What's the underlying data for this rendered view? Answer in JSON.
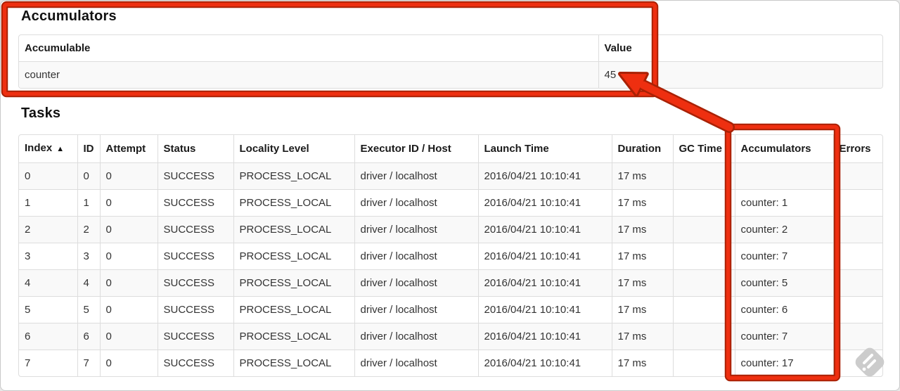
{
  "accumulators_section": {
    "title": "Accumulators",
    "table": {
      "headers": [
        "Accumulable",
        "Value"
      ],
      "rows": [
        [
          "counter",
          "45"
        ]
      ]
    }
  },
  "tasks_section": {
    "title": "Tasks",
    "table": {
      "headers": [
        "Index",
        "ID",
        "Attempt",
        "Status",
        "Locality Level",
        "Executor ID / Host",
        "Launch Time",
        "Duration",
        "GC Time",
        "Accumulators",
        "Errors"
      ],
      "sorted_column": "Index",
      "sort_icon": "▲",
      "rows": [
        [
          "0",
          "0",
          "0",
          "SUCCESS",
          "PROCESS_LOCAL",
          "driver / localhost",
          "2016/04/21 10:10:41",
          "17 ms",
          "",
          "",
          ""
        ],
        [
          "1",
          "1",
          "0",
          "SUCCESS",
          "PROCESS_LOCAL",
          "driver / localhost",
          "2016/04/21 10:10:41",
          "17 ms",
          "",
          "counter: 1",
          ""
        ],
        [
          "2",
          "2",
          "0",
          "SUCCESS",
          "PROCESS_LOCAL",
          "driver / localhost",
          "2016/04/21 10:10:41",
          "17 ms",
          "",
          "counter: 2",
          ""
        ],
        [
          "3",
          "3",
          "0",
          "SUCCESS",
          "PROCESS_LOCAL",
          "driver / localhost",
          "2016/04/21 10:10:41",
          "17 ms",
          "",
          "counter: 7",
          ""
        ],
        [
          "4",
          "4",
          "0",
          "SUCCESS",
          "PROCESS_LOCAL",
          "driver / localhost",
          "2016/04/21 10:10:41",
          "17 ms",
          "",
          "counter: 5",
          ""
        ],
        [
          "5",
          "5",
          "0",
          "SUCCESS",
          "PROCESS_LOCAL",
          "driver / localhost",
          "2016/04/21 10:10:41",
          "17 ms",
          "",
          "counter: 6",
          ""
        ],
        [
          "6",
          "6",
          "0",
          "SUCCESS",
          "PROCESS_LOCAL",
          "driver / localhost",
          "2016/04/21 10:10:41",
          "17 ms",
          "",
          "counter: 7",
          ""
        ],
        [
          "7",
          "7",
          "0",
          "SUCCESS",
          "PROCESS_LOCAL",
          "driver / localhost",
          "2016/04/21 10:10:41",
          "17 ms",
          "",
          "counter: 17",
          ""
        ]
      ]
    }
  },
  "annotations": {
    "highlight_color": "#ee2f10",
    "highlight_outline_color": "#a92105",
    "boxes": [
      "accumulators-summary-box",
      "accumulators-column-box"
    ],
    "arrow_points_to_value": "45"
  },
  "watermark": {
    "icon": "feather-icon",
    "color": "#cccccc"
  }
}
